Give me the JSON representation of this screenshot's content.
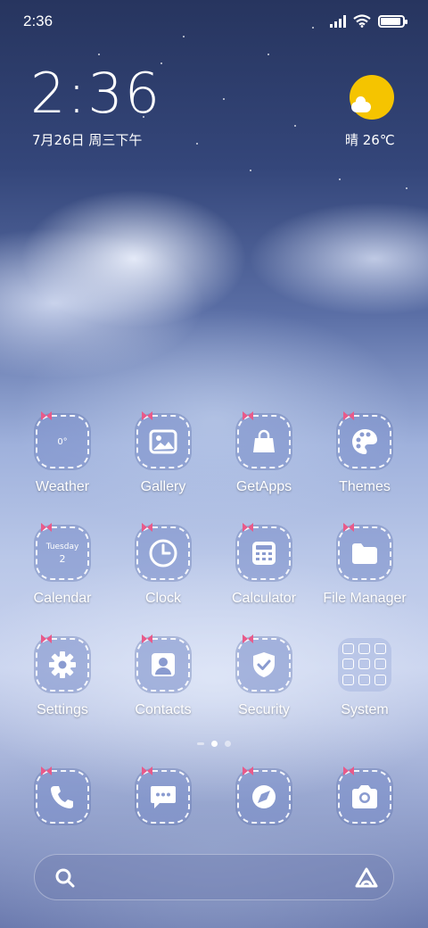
{
  "status_bar": {
    "time": "2:36",
    "battery_level": 0.85
  },
  "clock_widget": {
    "time": "2:36",
    "date": "7月26日 周三下午"
  },
  "weather_widget": {
    "condition_temp": "晴 26℃",
    "icon": "sun-cloud-icon",
    "sun_color": "#f5c400"
  },
  "apps": [
    {
      "label": "Weather",
      "icon": "weather-icon",
      "inner_text": "0°"
    },
    {
      "label": "Gallery",
      "icon": "gallery-icon"
    },
    {
      "label": "GetApps",
      "icon": "shopping-bag-icon"
    },
    {
      "label": "Themes",
      "icon": "palette-icon"
    },
    {
      "label": "Calendar",
      "icon": "calendar-icon",
      "inner_weekday": "Tuesday",
      "inner_day": "2"
    },
    {
      "label": "Clock",
      "icon": "clock-icon"
    },
    {
      "label": "Calculator",
      "icon": "calculator-icon"
    },
    {
      "label": "File Manager",
      "icon": "folder-icon"
    },
    {
      "label": "Settings",
      "icon": "gear-icon"
    },
    {
      "label": "Contacts",
      "icon": "contact-icon"
    },
    {
      "label": "Security",
      "icon": "shield-icon"
    },
    {
      "label": "System",
      "icon": "system-folder-icon"
    }
  ],
  "dock": [
    {
      "icon": "phone-icon"
    },
    {
      "icon": "messages-icon"
    },
    {
      "icon": "browser-icon"
    },
    {
      "icon": "camera-icon"
    }
  ],
  "page_indicator": {
    "pages": 2,
    "active": 1
  },
  "colors": {
    "icon_bg": "#7f92c8",
    "accent_bow": "#e85a8a"
  }
}
